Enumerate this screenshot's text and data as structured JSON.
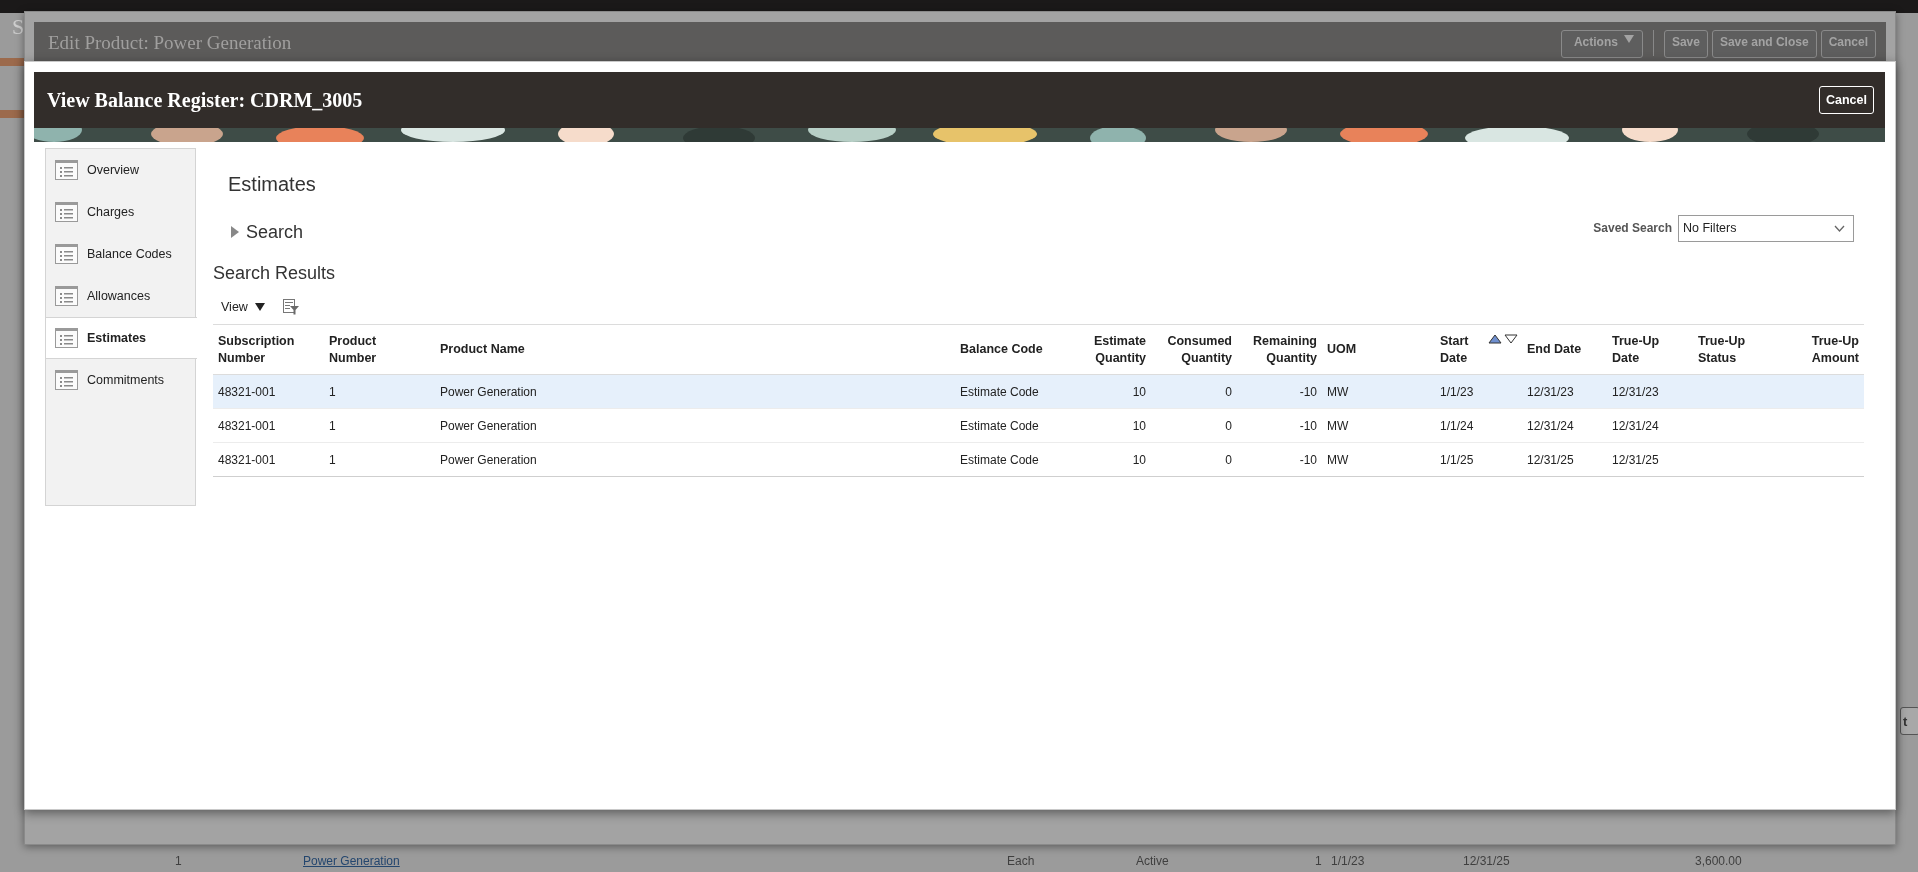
{
  "background_page": {
    "header_fragment": "S",
    "button_fragment": "t",
    "row": [
      "1",
      "Power Generation",
      "Each",
      "Active",
      "1",
      "1/1/23",
      "12/31/25",
      "3,600.00"
    ]
  },
  "edit_dialog": {
    "title": "Edit Product: Power Generation",
    "buttons": [
      {
        "label": "Actions",
        "kind": "menu"
      },
      {
        "label": "Save",
        "kind": "button"
      },
      {
        "label": "Save and Close",
        "kind": "button"
      },
      {
        "label": "Cancel",
        "kind": "button"
      }
    ]
  },
  "dialog": {
    "title": "View Balance Register: CDRM_3005",
    "cancel": "Cancel"
  },
  "sidebar": {
    "items": [
      {
        "label": "Overview",
        "selected": false
      },
      {
        "label": "Charges",
        "selected": false
      },
      {
        "label": "Balance Codes",
        "selected": false
      },
      {
        "label": "Allowances",
        "selected": false
      },
      {
        "label": "Estimates",
        "selected": true
      },
      {
        "label": "Commitments",
        "selected": false
      }
    ]
  },
  "content": {
    "title": "Estimates",
    "search": {
      "label": "Search",
      "expanded": false
    },
    "saved_search": {
      "label": "Saved Search",
      "value": "No Filters"
    },
    "results_title": "Search Results",
    "toolbar": {
      "view": "View"
    }
  },
  "table": {
    "columns": [
      {
        "label": "Subscription Number",
        "kind": "text"
      },
      {
        "label": "Product Number",
        "kind": "text"
      },
      {
        "label": "Product Name",
        "kind": "text"
      },
      {
        "label": "Balance Code",
        "kind": "text"
      },
      {
        "label": "Estimate Quantity",
        "kind": "number"
      },
      {
        "label": "Consumed Quantity",
        "kind": "number"
      },
      {
        "label": "Remaining Quantity",
        "kind": "number"
      },
      {
        "label": "UOM",
        "kind": "text"
      },
      {
        "label": "Start Date",
        "kind": "text",
        "sort_ascending": true
      },
      {
        "label": "End Date",
        "kind": "text"
      },
      {
        "label": "True-Up Date",
        "kind": "text"
      },
      {
        "label": "True-Up Status",
        "kind": "text"
      },
      {
        "label": "True-Up Amount",
        "kind": "number"
      }
    ],
    "rows": [
      {
        "selected": true,
        "cells": [
          "48321-001",
          "1",
          "Power Generation",
          "Estimate Code",
          "10",
          "0",
          "-10",
          "MW",
          "1/1/23",
          "12/31/23",
          "12/31/23"
        ]
      },
      {
        "selected": false,
        "cells": [
          "48321-001",
          "1",
          "Power Generation",
          "Estimate Code",
          "10",
          "0",
          "-10",
          "MW",
          "1/1/24",
          "12/31/24",
          "12/31/24"
        ]
      },
      {
        "selected": false,
        "cells": [
          "48321-001",
          "1",
          "Power Generation",
          "Estimate Code",
          "10",
          "0",
          "-10",
          "MW",
          "1/1/25",
          "12/31/25",
          "12/31/25"
        ]
      }
    ]
  }
}
